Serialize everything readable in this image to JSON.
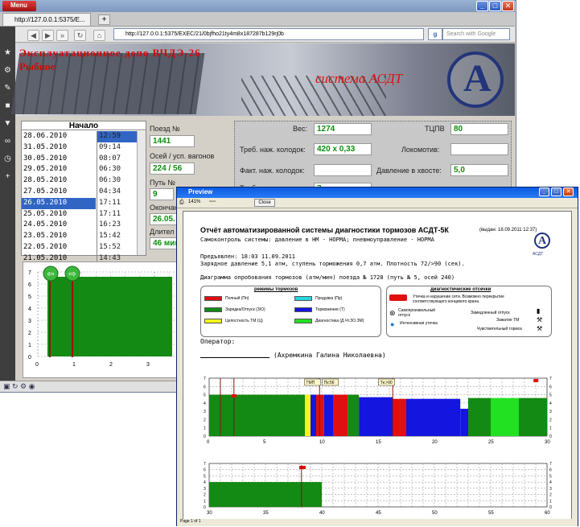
{
  "opera": {
    "menu_label": "Menu",
    "tab_title": "http://127.0.0.1:5375/E...",
    "address": "http://127.0.0.1:5375/EXEC/21/0bjfho21ty4m8x187287b129rj0b",
    "search_placeholder": "Search with Google",
    "search_engine_glyph": "g",
    "new_tab_glyph": "+",
    "min_glyph": "_",
    "max_glyph": "□",
    "close_glyph": "✕",
    "nav": {
      "back": "◀",
      "fwd": "▶",
      "ffwd": "»",
      "stop": "✕",
      "reload": "↻",
      "home": "⌂"
    }
  },
  "banner": {
    "line1": "Эксплуатационное депо ВЧДЭ-26",
    "line2": "Рыбное",
    "system_name": "система АСДТ",
    "logo_letter": "А"
  },
  "left_panel": {
    "header": "Начало",
    "dates": [
      "28.06.2010",
      "31.05.2010",
      "30.05.2010",
      "29.05.2010",
      "28.05.2010",
      "27.05.2010",
      "26.05.2010",
      "25.05.2010",
      "24.05.2010",
      "23.05.2010",
      "22.05.2010",
      "21.05.2010"
    ],
    "times": [
      "12:59",
      "09:14",
      "08:07",
      "06:30",
      "06:30",
      "04:34",
      "17:11",
      "17:11",
      "16:23",
      "15:42",
      "15:52",
      "14:43"
    ],
    "selected_date_index": 6,
    "selected_time_index": 0
  },
  "mid_panel": {
    "train_label": "Поезд №",
    "train_value": "1441",
    "axles_label": "Осей / усп. вагонов",
    "axles_value": "224 / 56",
    "track_label": "Путь №",
    "track_value": "9",
    "end_label": "Окончан",
    "end_value": "26.05.",
    "dur_label": "Длител",
    "dur_value": "46 мин"
  },
  "right_panel": {
    "weight_label": "Вес:",
    "weight_value": "1274",
    "tcpv_label": "ТЦПВ",
    "tcpv_value": "80",
    "req_pads_label": "Треб. наж. колодок:",
    "req_pads_value": "420 x 0,33",
    "loco_label": "Локомотив:",
    "loco_value": "",
    "fact_pads_label": "Факт. наж. колодок:",
    "fact_pads_value": "",
    "tail_label": "Давление в хвосте:",
    "tail_value": "5,0",
    "req_brakes_label": "Треб. наж. торм:",
    "req_brakes_value": "7"
  },
  "opera_chart": {
    "y_ticks": [
      "0",
      "1",
      "2",
      "3",
      "4",
      "5",
      "6",
      "7"
    ],
    "x_ticks": [
      "0",
      "1",
      "2",
      "3"
    ],
    "nav_prev": "⇦",
    "nav_next": "⇨"
  },
  "preview": {
    "window_title": "Preview",
    "zoom": "141%",
    "close_button": "Close",
    "title": "Отчёт автоматизированной системы диагностики тормозов АСДТ-5К",
    "title_suffix": "(выдан: 18.09.2011 12:37)",
    "selfcheck": "Самоконтроль системы: давление в НМ - НОРМА; пневмоуправление - НОРМА",
    "presented": "Предъявлен: 18:03  11.09.2011",
    "charge_line": "Зарядное давление 5,1 атм, ступень торможения 0,7 атм. Плотность 72/>90 (сек).",
    "diagram_line": "Диаграмма опробования тормозов (атм/мин) поезда № 1728 (путь № 5, осей 240)",
    "operator_label": "Оператор:",
    "operator_name": "(Ахремкина Галина Николаевна)",
    "logo_text": "АСДТ",
    "modes_title": "режимы тормозов",
    "modes": [
      {
        "label": "Полный (Пп)",
        "color": "#e01010"
      },
      {
        "label": "Продувка (Пр)",
        "color": "#22d8e0"
      },
      {
        "label": "Зарядка/Отпуск (З/О)",
        "color": "#138a13"
      },
      {
        "label": "Торможение (Т)",
        "color": "#1515e0"
      },
      {
        "label": "Целостность ТМ (Ц)",
        "color": "#f5f51a"
      },
      {
        "label": "Диагностика (Д.Чт.ЗО.ЗМ)",
        "color": "#22e022"
      }
    ],
    "diag_title": "диагностические отсечки",
    "diag_items": [
      "Утечка и нарушение сети. Возможно перекрытие соответствующего концевого крана.",
      "Самопроизвольный отпуск",
      "Замедленный отпуск",
      "Зажатие ТМ",
      "Интенсивная утечка",
      "Чувствительный тормоз"
    ],
    "chart1": {
      "x_ticks": [
        "0",
        "5",
        "10",
        "15",
        "20",
        "25",
        "30"
      ],
      "y_ticks": [
        "0",
        "1",
        "2",
        "3",
        "4",
        "5",
        "6",
        "7"
      ],
      "flags": [
        "ТМП",
        "Пк:56",
        "Тк:>90"
      ]
    },
    "chart2": {
      "x_ticks": [
        "30",
        "35",
        "40",
        "45",
        "50",
        "55",
        "60"
      ],
      "y_ticks": [
        "0",
        "1",
        "2",
        "3",
        "4",
        "5",
        "6",
        "7"
      ]
    },
    "page_status": "Page 1 of 1"
  },
  "chart_data": [
    {
      "type": "area",
      "title": "",
      "x_range": [
        0,
        30
      ],
      "y_range": [
        0,
        7
      ],
      "segments": [
        {
          "x": [
            0,
            8.5
          ],
          "y": 5,
          "color": "#138a13"
        },
        {
          "x": [
            8.5,
            9
          ],
          "y": 5,
          "color": "#f5f51a"
        },
        {
          "x": [
            9,
            9.5
          ],
          "y": 5,
          "color": "#1515e0"
        },
        {
          "x": [
            9.5,
            10.2
          ],
          "y": 5,
          "color": "#e01010"
        },
        {
          "x": [
            10.2,
            11
          ],
          "y": 5,
          "color": "#1515e0"
        },
        {
          "x": [
            11,
            12.3
          ],
          "y": 5,
          "color": "#e01010"
        },
        {
          "x": [
            12.3,
            13.3
          ],
          "y": 5,
          "color": "#138a13"
        },
        {
          "x": [
            13.3,
            16.3
          ],
          "y": 4.7,
          "color": "#1515e0"
        },
        {
          "x": [
            16.3,
            17.5
          ],
          "y": 4.5,
          "color": "#e01010"
        },
        {
          "x": [
            17.5,
            22.3
          ],
          "y": 4.5,
          "color": "#1515e0"
        },
        {
          "x": [
            22.3,
            23
          ],
          "y": 3.3,
          "color": "#1515e0"
        },
        {
          "x": [
            23,
            25
          ],
          "y": 4.6,
          "color": "#138a13"
        },
        {
          "x": [
            25,
            27.5
          ],
          "y": 4.6,
          "color": "#22e022"
        },
        {
          "x": [
            27.5,
            30
          ],
          "y": 4.6,
          "color": "#138a13"
        }
      ]
    },
    {
      "type": "area",
      "title": "",
      "x_range": [
        30,
        60
      ],
      "y_range": [
        0,
        7
      ],
      "segments": [
        {
          "x": [
            30,
            40
          ],
          "y": 4,
          "color": "#138a13"
        }
      ]
    }
  ]
}
